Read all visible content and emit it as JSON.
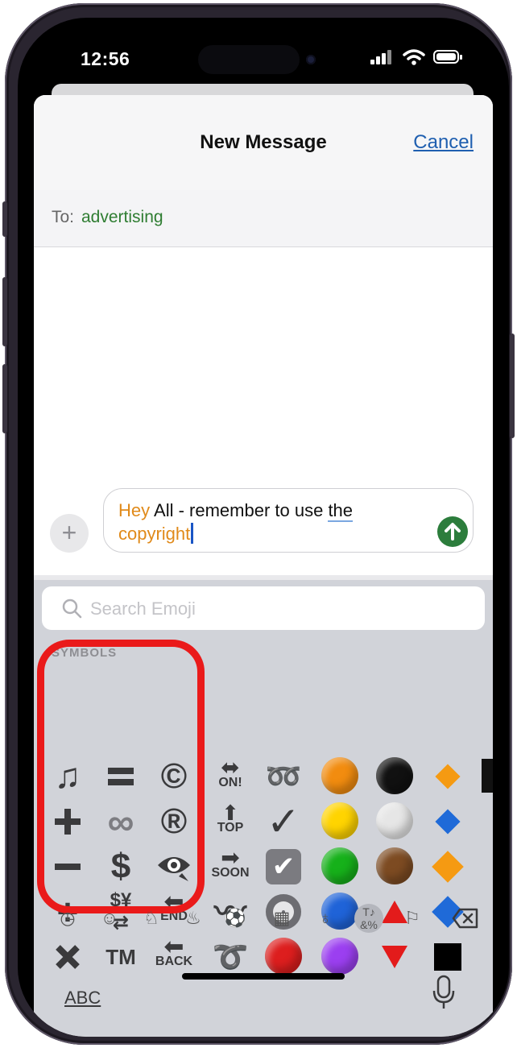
{
  "status": {
    "time": "12:56"
  },
  "nav": {
    "title": "New Message",
    "cancel_label": "Cancel"
  },
  "to": {
    "label": "To:",
    "value": "advertising"
  },
  "compose": {
    "word1": "Hey",
    "middle": " All - remember to use ",
    "word2": "the",
    "word3": "copyright"
  },
  "search": {
    "placeholder": "Search Emoji"
  },
  "emoji": {
    "category_label": "SYMBOLS",
    "arrow_labels": {
      "on": "ON!",
      "top": "TOP",
      "soon": "SOON",
      "end": "END",
      "back": "BACK"
    },
    "tm": "TM"
  },
  "keyboard": {
    "abc_label": "ABC"
  },
  "colors": {
    "send": "#2c7d3c",
    "highlight": "#ea1a1a",
    "link": "#1f5fb0",
    "recipient": "#2f7d32",
    "accent_text": "#e08a1a"
  },
  "icons": {
    "row1": [
      "notes-icon",
      "equals-icon",
      "copyright-icon",
      "on-arrow-icon",
      "loop-icon",
      "orange-circle",
      "black-circle",
      "orange-diamond"
    ],
    "categories": [
      "clock-icon",
      "smiley-icon",
      "animal-icon",
      "food-icon",
      "ball-icon",
      "building-icon",
      "bulb-icon",
      "symbols-icon",
      "flag-icon",
      "delete-key-icon"
    ]
  }
}
